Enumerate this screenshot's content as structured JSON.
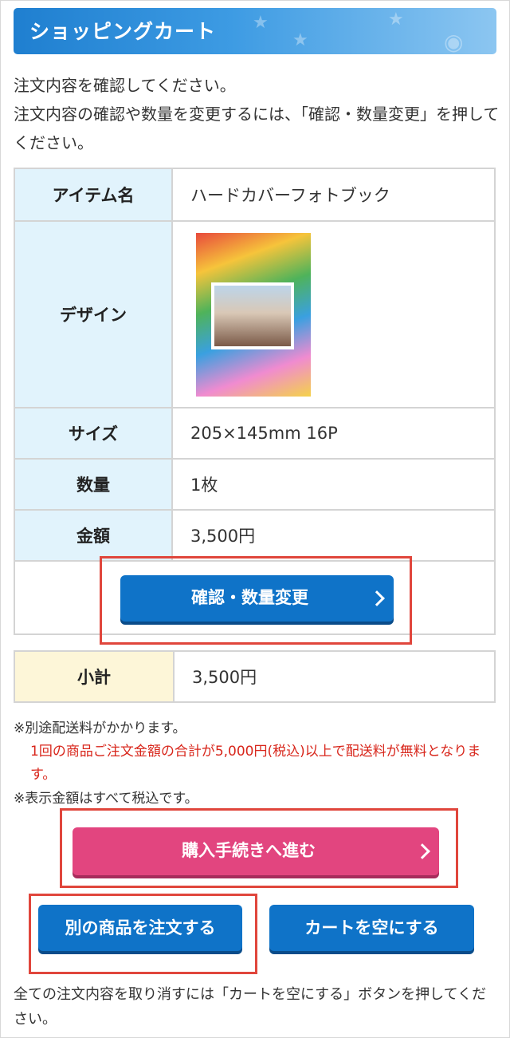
{
  "header": {
    "title": "ショッピングカート"
  },
  "intro": {
    "line1": "注文内容を確認してください。",
    "line2": "注文内容の確認や数量を変更するには、「確認・数量変更」を押してください。"
  },
  "cart": {
    "rows": [
      {
        "label": "アイテム名",
        "value": "ハードカバーフォトブック"
      },
      {
        "label": "デザイン",
        "value": ""
      },
      {
        "label": "サイズ",
        "value": "205×145mm 16P"
      },
      {
        "label": "数量",
        "value": "1枚"
      },
      {
        "label": "金額",
        "value": "3,500円"
      }
    ],
    "confirm_button": "確認・数量変更"
  },
  "subtotal": {
    "label": "小計",
    "value": "3,500円"
  },
  "notes": {
    "shipping": "※別途配送料がかかります。",
    "free_shipping": "1回の商品ご注文金額の合計が5,000円(税込)以上で配送料が無料となります。",
    "tax": "※表示金額はすべて税込です。"
  },
  "buttons": {
    "checkout": "購入手続きへ進む",
    "order_other": "別の商品を注文する",
    "empty_cart": "カートを空にする"
  },
  "footer": {
    "note": "全ての注文内容を取り消すには「カートを空にする」ボタンを押してください。"
  },
  "colors": {
    "accent_blue": "#0f73c8",
    "pink": "#e2457f",
    "highlight_red": "#e0463c"
  }
}
